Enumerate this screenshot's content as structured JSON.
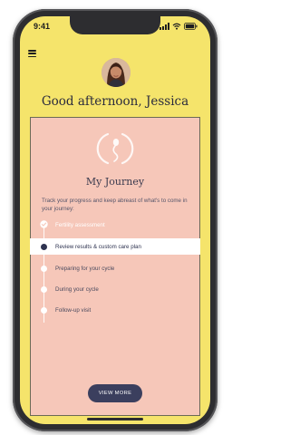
{
  "status_bar": {
    "time": "9:41"
  },
  "header": {
    "greeting": "Good afternoon, Jessica"
  },
  "journey": {
    "title": "My Journey",
    "description": "Track your progress and keep abreast of what's to come in your journey:",
    "steps": [
      {
        "label": "Fertility assessment",
        "state": "completed"
      },
      {
        "label": "Review results & custom care plan",
        "state": "current"
      },
      {
        "label": "Preparing for your cycle",
        "state": "upcoming"
      },
      {
        "label": "During your cycle",
        "state": "upcoming"
      },
      {
        "label": "Follow-up visit",
        "state": "upcoming"
      }
    ],
    "view_more_label": "VIEW MORE"
  },
  "colors": {
    "header_background": "#f5e46b",
    "card_background": "#f6c7b9",
    "accent_navy": "#3b3f5e",
    "text_dark": "#2b2b3d"
  },
  "icons": {
    "menu": "hamburger-menu-icon",
    "journey": "sperm-circle-icon",
    "completed_step": "check-icon"
  }
}
